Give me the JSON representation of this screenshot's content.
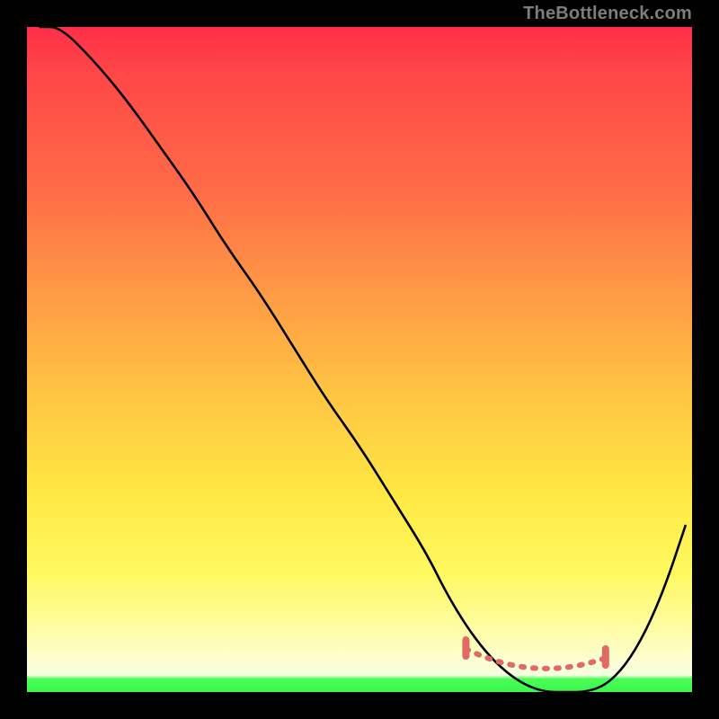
{
  "watermark": "TheBottleneck.com",
  "colors": {
    "background": "#000000",
    "gradient_top": "#ff2e49",
    "gradient_mid1": "#ff9a45",
    "gradient_mid2": "#ffe843",
    "gradient_low": "#fefed0",
    "gradient_green": "#3cf54e",
    "curve": "#000000",
    "tolerance": "#e06a66"
  },
  "chart_data": {
    "type": "line",
    "title": "",
    "xlabel": "",
    "ylabel": "",
    "xlim": [
      0,
      100
    ],
    "ylim": [
      0,
      100
    ],
    "grid": false,
    "series": [
      {
        "name": "bottleneck-curve",
        "x": [
          2,
          5,
          10,
          15,
          20,
          25,
          30,
          35,
          40,
          45,
          50,
          55,
          60,
          63,
          66,
          69,
          72,
          75,
          78,
          81,
          84,
          87,
          90,
          93,
          96,
          99
        ],
        "values": [
          100,
          100,
          95,
          89,
          82,
          75,
          67,
          60,
          52,
          44,
          37,
          29,
          21,
          15,
          10,
          6,
          3,
          1,
          0,
          0,
          0,
          1,
          4,
          9,
          16,
          25
        ]
      }
    ],
    "annotations": [
      {
        "name": "tolerance-band",
        "x_start": 66,
        "x_end": 87,
        "style": "dotted",
        "color": "#e06a66"
      }
    ]
  }
}
